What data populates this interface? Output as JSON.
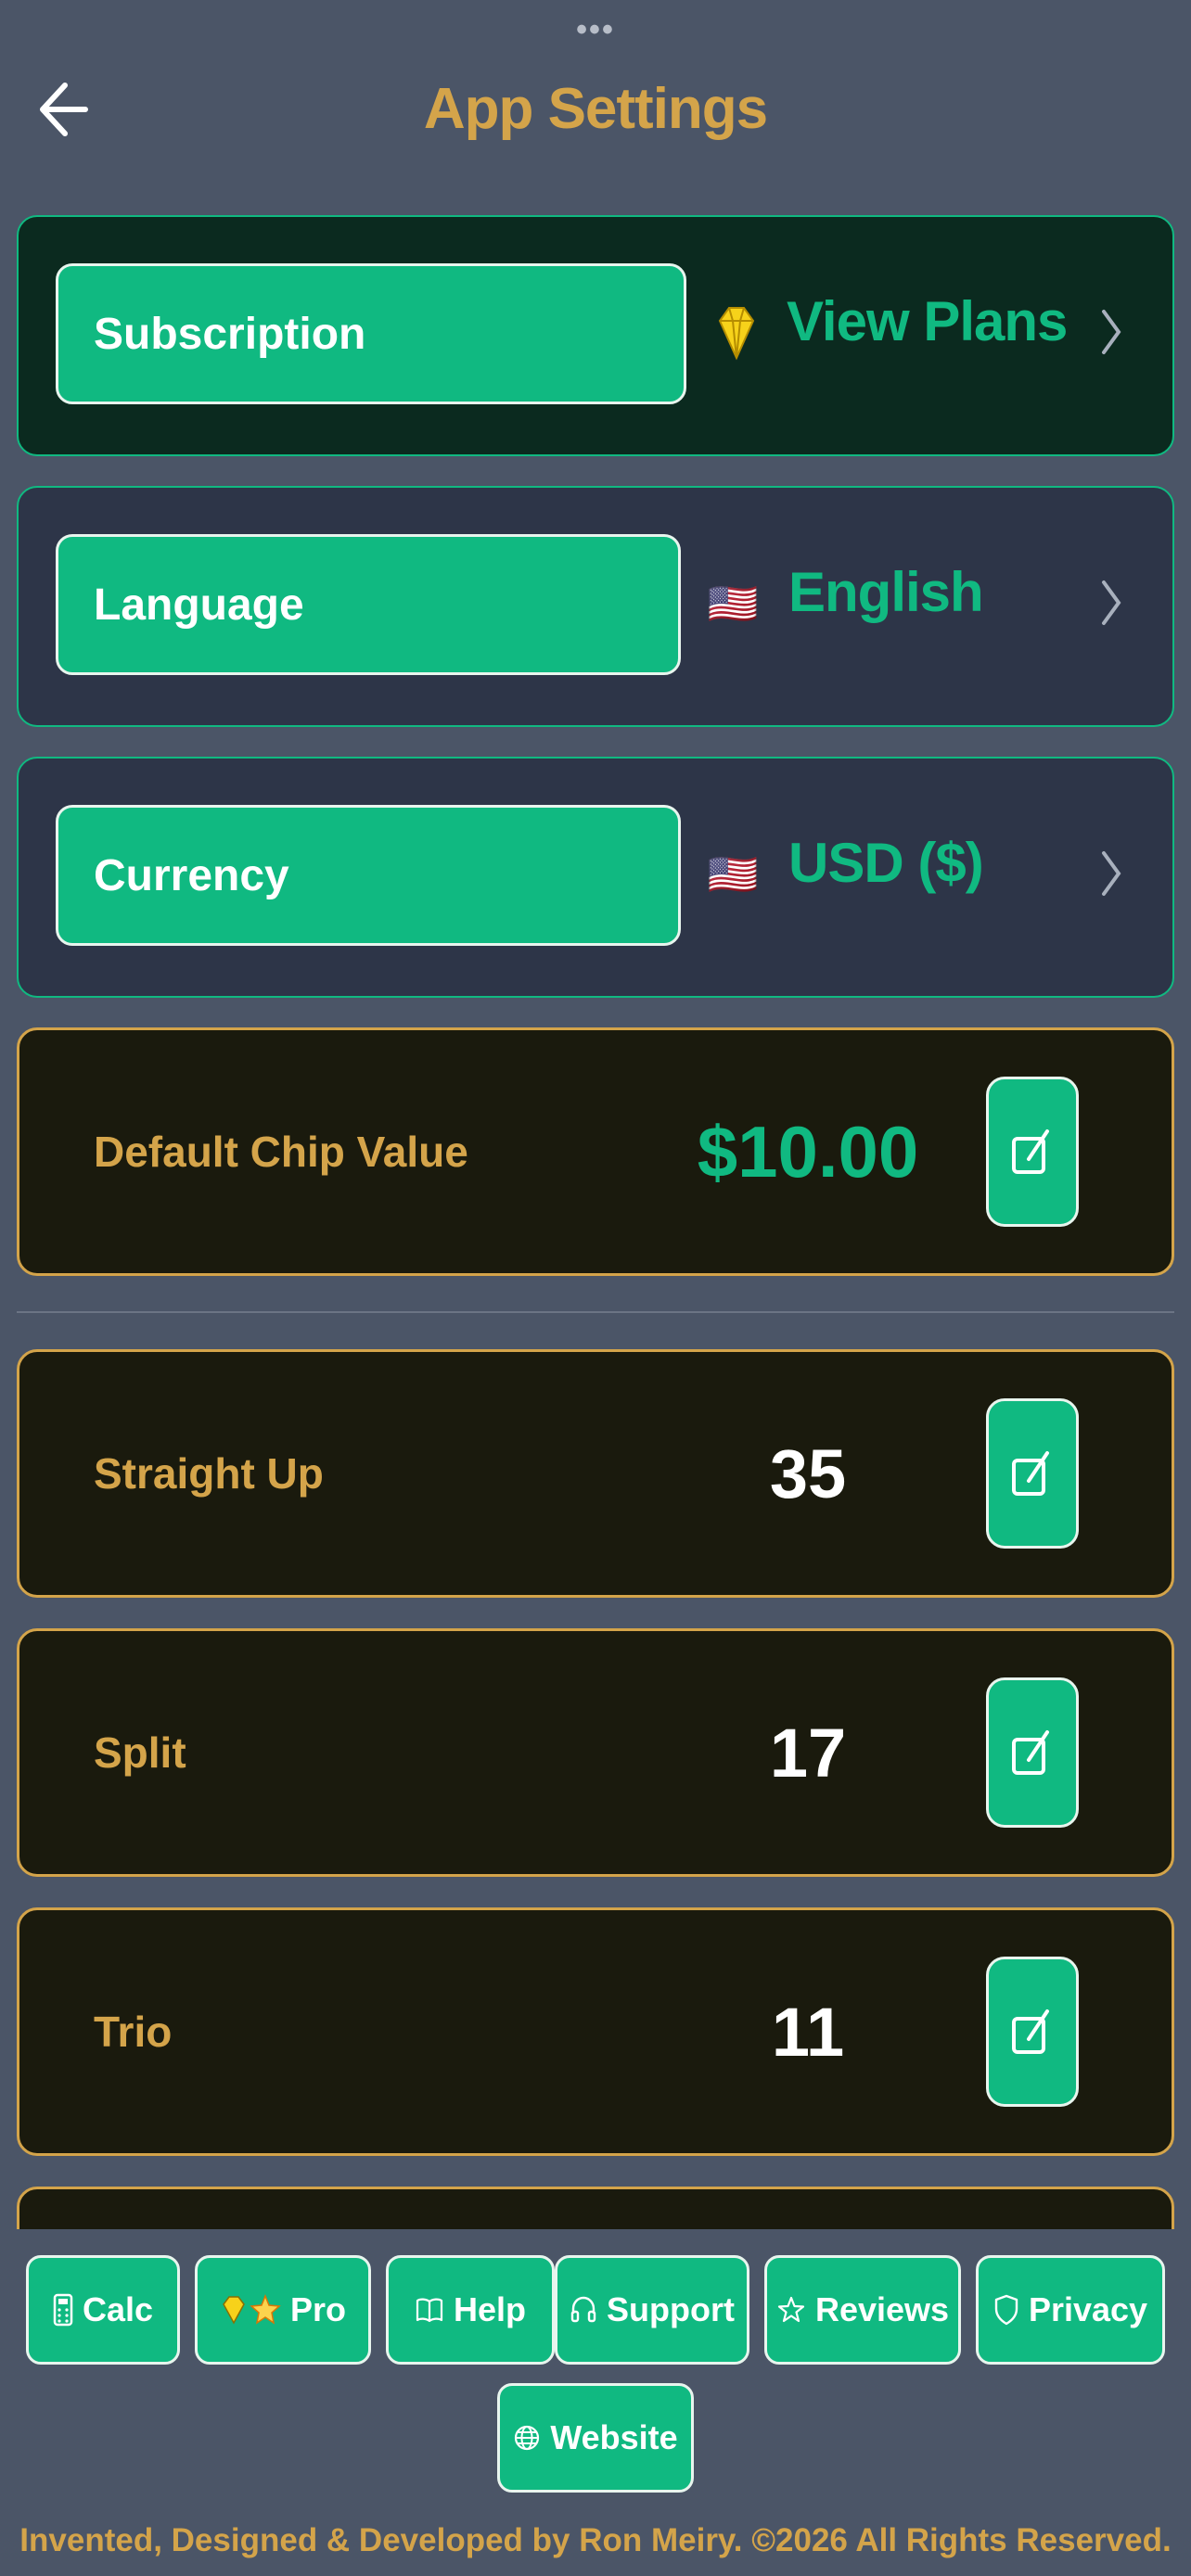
{
  "header": {
    "title": "App Settings",
    "grabber": "•••",
    "back_icon": "arrow-left-icon"
  },
  "settings": {
    "subscription": {
      "label": "Subscription",
      "value": "View Plans",
      "icon": "diamond-icon"
    },
    "language": {
      "label": "Language",
      "value": "English",
      "flag": "🇺🇸"
    },
    "currency": {
      "label": "Currency",
      "value": "USD ($)",
      "flag": "🇺🇸"
    }
  },
  "chip": {
    "label": "Default Chip Value",
    "value": "$10.00"
  },
  "payouts": [
    {
      "label": "Straight Up",
      "value": "35"
    },
    {
      "label": "Split",
      "value": "17"
    },
    {
      "label": "Trio",
      "value": "11"
    }
  ],
  "nav": {
    "calc": "Calc",
    "pro": "Pro",
    "help": "Help",
    "support": "Support",
    "reviews": "Reviews",
    "privacy": "Privacy",
    "website": "Website"
  },
  "footer": "Invented, Designed & Developed by Ron Meiry. ©2026 All Rights Reserved.",
  "colors": {
    "background": "#4b5567",
    "accent_green": "#10b981",
    "accent_gold": "#d4a44a",
    "dark_card": "#1a1a0d"
  }
}
